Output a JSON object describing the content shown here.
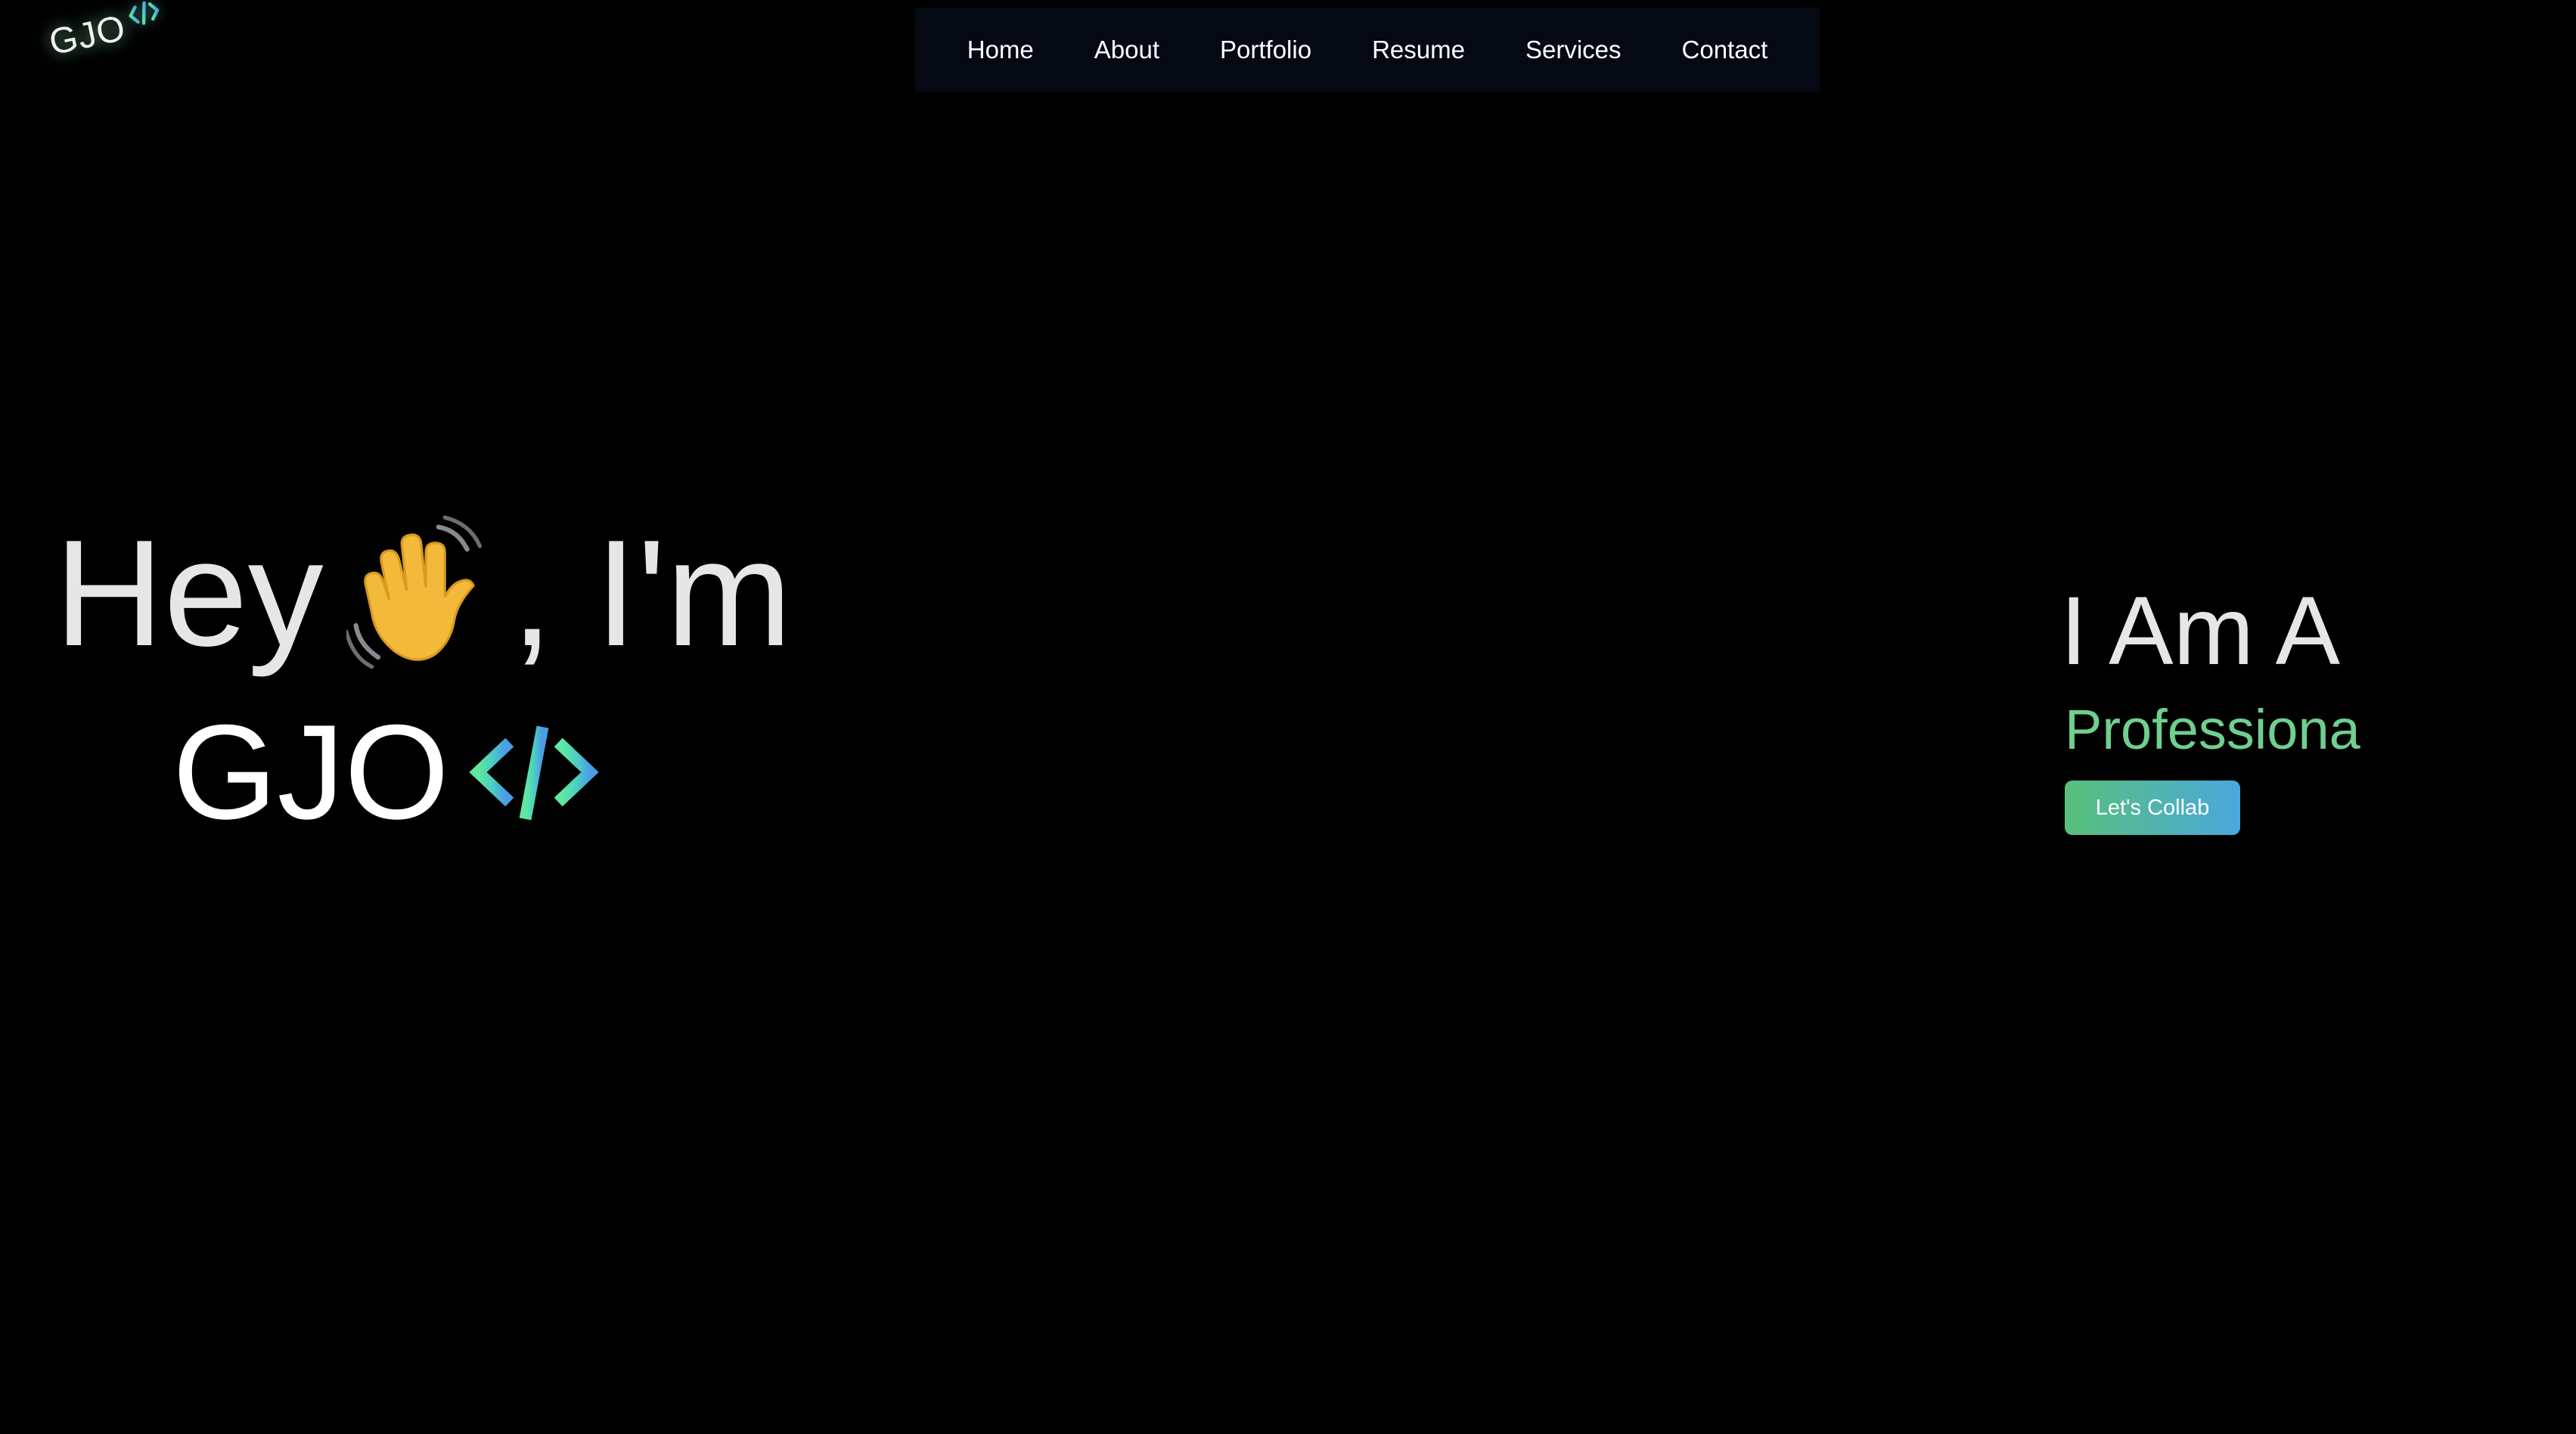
{
  "logo": {
    "text": "GJO",
    "icon": "code-brackets-icon"
  },
  "nav": {
    "items": [
      {
        "label": "Home"
      },
      {
        "label": "About"
      },
      {
        "label": "Portfolio"
      },
      {
        "label": "Resume"
      },
      {
        "label": "Services"
      },
      {
        "label": "Contact"
      }
    ]
  },
  "hero": {
    "greeting_hey": "Hey",
    "greeting_wave_icon": "waving-hand-icon",
    "greeting_im": ", I'm",
    "name": "GJO",
    "name_icon": "code-brackets-icon"
  },
  "role": {
    "prefix": "I Am A",
    "typed": "Professiona",
    "cta_label": "Let's Collab"
  },
  "colors": {
    "background": "#000000",
    "nav_background": "#050914",
    "accent_green": "#6fcf8f",
    "accent_blue": "#4aa8dc",
    "text": "#e6e6e6"
  }
}
